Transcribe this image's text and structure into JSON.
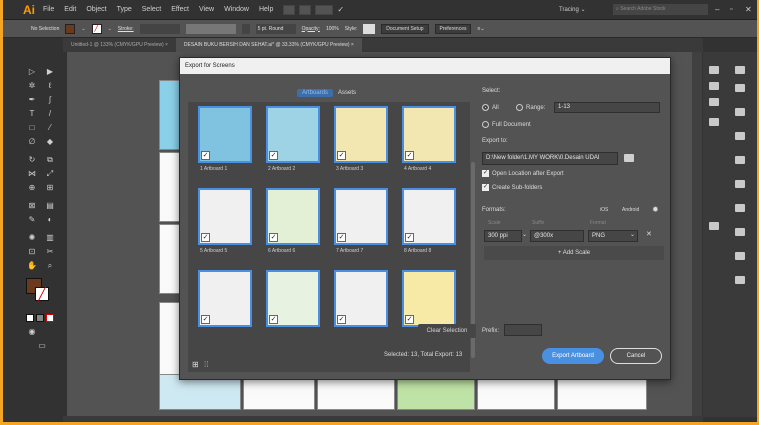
{
  "app": {
    "logo": "Ai"
  },
  "menu": [
    "File",
    "Edit",
    "Object",
    "Type",
    "Select",
    "Effect",
    "View",
    "Window",
    "Help"
  ],
  "menubar_right": {
    "workspace": "Tracing",
    "search_placeholder": "Search Adobe Stock"
  },
  "options_bar": {
    "selection": "No Selection",
    "stroke": "Stroke:",
    "brush": "5 pt. Round",
    "opacity": "Opacity:",
    "opacity_value": "100%",
    "style": "Style:",
    "document_setup": "Document Setup",
    "preferences": "Preferences"
  },
  "doc_tabs": [
    "Untitled-1 @ 133% (CMYK/GPU Preview)",
    "DESAIN BUKU BERSIH DAN SEHAT.ai* @ 33.33% (CMYK/GPU Preview)"
  ],
  "dialog": {
    "title": "Export for Screens",
    "tabs": [
      "Artboards",
      "Assets"
    ],
    "selected_tab": "Artboards",
    "artboards": [
      "1 Artboard 1",
      "2 Artboard 2",
      "3 Artboard 3",
      "4 Artboard 4",
      "5 Artboard 5",
      "6 Artboard 6",
      "7 Artboard 7",
      "8 Artboard 8",
      "",
      "",
      "",
      ""
    ],
    "select_label": "Select:",
    "all_label": "All",
    "range_label": "Range:",
    "range_value": "1-13",
    "full_document": "Full Document",
    "export_to": "Export to:",
    "export_path": "D:\\New folder\\1.MY WORK\\0.Desain UDAI",
    "open_location": "Open Location after Export",
    "create_subfolders": "Create Sub-folders",
    "formats_label": "Formats:",
    "ios": "iOS",
    "android": "Android",
    "col_scale": "Scale",
    "col_suffix": "Suffix",
    "col_format": "Format",
    "scale_value": "300 ppi",
    "suffix_value": "@300x",
    "format_value": "PNG",
    "add_scale": "+ Add Scale",
    "clear_selection": "Clear Selection",
    "prefix_label": "Prefix:",
    "status": "Selected: 13, Total Export: 13",
    "export_button": "Export Artboard",
    "cancel_button": "Cancel"
  },
  "colors": {
    "accent": "#4a90e2",
    "dialog_bg": "#535353",
    "frame_border": "#f5a524",
    "fill_swatch": "#6b3a1e"
  }
}
